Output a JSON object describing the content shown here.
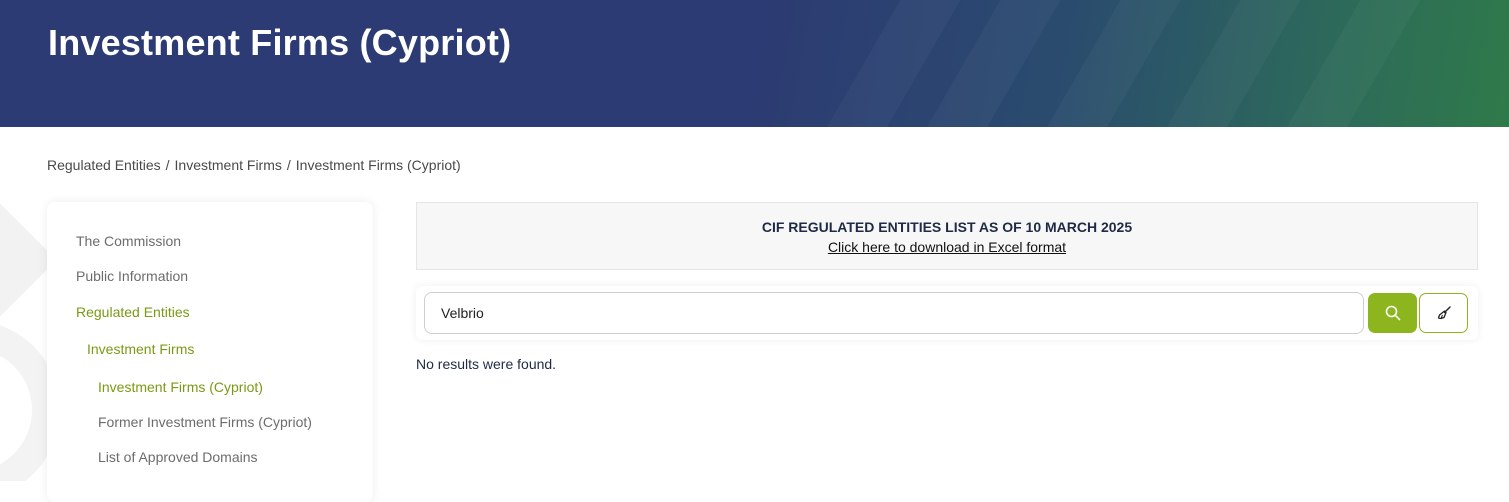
{
  "header": {
    "title": "Investment Firms (Cypriot)"
  },
  "breadcrumb": [
    "Regulated Entities",
    "Investment Firms",
    "Investment Firms (Cypriot)"
  ],
  "breadcrumb_sep": "/",
  "sidebar": {
    "items": [
      {
        "label": "The Commission"
      },
      {
        "label": "Public Information"
      },
      {
        "label": "Regulated Entities"
      },
      {
        "label": "Investment Firms"
      },
      {
        "label": "Investment Firms (Cypriot)"
      },
      {
        "label": "Former Investment Firms (Cypriot)"
      },
      {
        "label": "List of Approved Domains"
      }
    ]
  },
  "notice": {
    "title": "CIF REGULATED ENTITIES LIST AS OF 10 MARCH 2025",
    "download_link": "Click here to download in Excel format"
  },
  "search": {
    "value": "Velbrio"
  },
  "results": {
    "message": "No results were found."
  },
  "colors": {
    "accent": "#8db51e",
    "active_nav": "#7a9a14",
    "header_start": "#2c3b73",
    "header_end": "#2f7a4a"
  },
  "icons": {
    "search": "search-icon",
    "clear": "broom-icon"
  }
}
